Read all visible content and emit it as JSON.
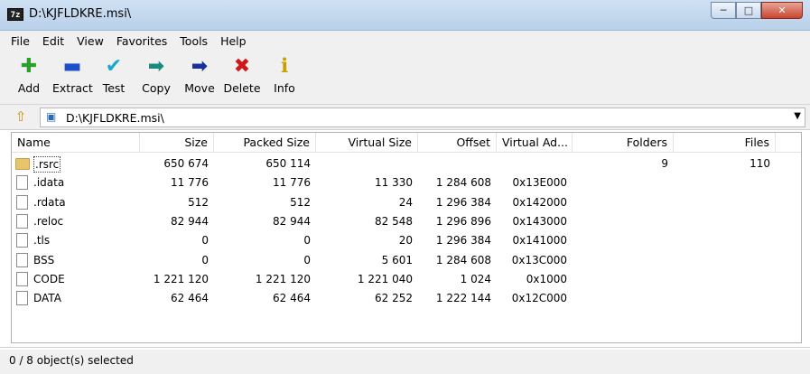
{
  "window": {
    "icon_label": "7z",
    "title": "D:\\KJFLDKRE.msi\\",
    "minimize_glyph": "─",
    "maximize_glyph": "□",
    "close_glyph": "✕"
  },
  "menu": [
    "File",
    "Edit",
    "View",
    "Favorites",
    "Tools",
    "Help"
  ],
  "toolbar": [
    {
      "label": "Add",
      "icon": "add-icon",
      "glyph": "✚",
      "color": "#2aa02a"
    },
    {
      "label": "Extract",
      "icon": "extract-icon",
      "glyph": "▬",
      "color": "#1f4fc8"
    },
    {
      "label": "Test",
      "icon": "test-icon",
      "glyph": "✔",
      "color": "#19a7c9"
    },
    {
      "label": "Copy",
      "icon": "copy-icon",
      "glyph": "➡",
      "color": "#1a8a7a"
    },
    {
      "label": "Move",
      "icon": "move-icon",
      "glyph": "➡",
      "color": "#1a2f9a"
    },
    {
      "label": "Delete",
      "icon": "delete-icon",
      "glyph": "✖",
      "color": "#d01818"
    },
    {
      "label": "Info",
      "icon": "info-icon",
      "glyph": "ℹ",
      "color": "#c9a000"
    }
  ],
  "address": {
    "path": "D:\\KJFLDKRE.msi\\",
    "up_glyph": "⇧",
    "archive_glyph": "▣",
    "dropdown_glyph": "▼"
  },
  "columns": [
    "Name",
    "Size",
    "Packed Size",
    "Virtual Size",
    "Offset",
    "Virtual Ad...",
    "Folders",
    "Files"
  ],
  "rows": [
    {
      "type": "folder",
      "name": ".rsrc",
      "size": "650 674",
      "packed": "650 114",
      "vsize": "",
      "offset": "",
      "vaddr": "",
      "folders": "9",
      "files": "110"
    },
    {
      "type": "file",
      "name": ".idata",
      "size": "11 776",
      "packed": "11 776",
      "vsize": "11 330",
      "offset": "1 284 608",
      "vaddr": "0x13E000",
      "folders": "",
      "files": ""
    },
    {
      "type": "file",
      "name": ".rdata",
      "size": "512",
      "packed": "512",
      "vsize": "24",
      "offset": "1 296 384",
      "vaddr": "0x142000",
      "folders": "",
      "files": ""
    },
    {
      "type": "file",
      "name": ".reloc",
      "size": "82 944",
      "packed": "82 944",
      "vsize": "82 548",
      "offset": "1 296 896",
      "vaddr": "0x143000",
      "folders": "",
      "files": ""
    },
    {
      "type": "file",
      "name": ".tls",
      "size": "0",
      "packed": "0",
      "vsize": "20",
      "offset": "1 296 384",
      "vaddr": "0x141000",
      "folders": "",
      "files": ""
    },
    {
      "type": "file",
      "name": "BSS",
      "size": "0",
      "packed": "0",
      "vsize": "5 601",
      "offset": "1 284 608",
      "vaddr": "0x13C000",
      "folders": "",
      "files": ""
    },
    {
      "type": "file",
      "name": "CODE",
      "size": "1 221 120",
      "packed": "1 221 120",
      "vsize": "1 221 040",
      "offset": "1 024",
      "vaddr": "0x1000",
      "folders": "",
      "files": ""
    },
    {
      "type": "file",
      "name": "DATA",
      "size": "62 464",
      "packed": "62 464",
      "vsize": "62 252",
      "offset": "1 222 144",
      "vaddr": "0x12C000",
      "folders": "",
      "files": ""
    }
  ],
  "status": {
    "text": "0 / 8 object(s) selected"
  }
}
